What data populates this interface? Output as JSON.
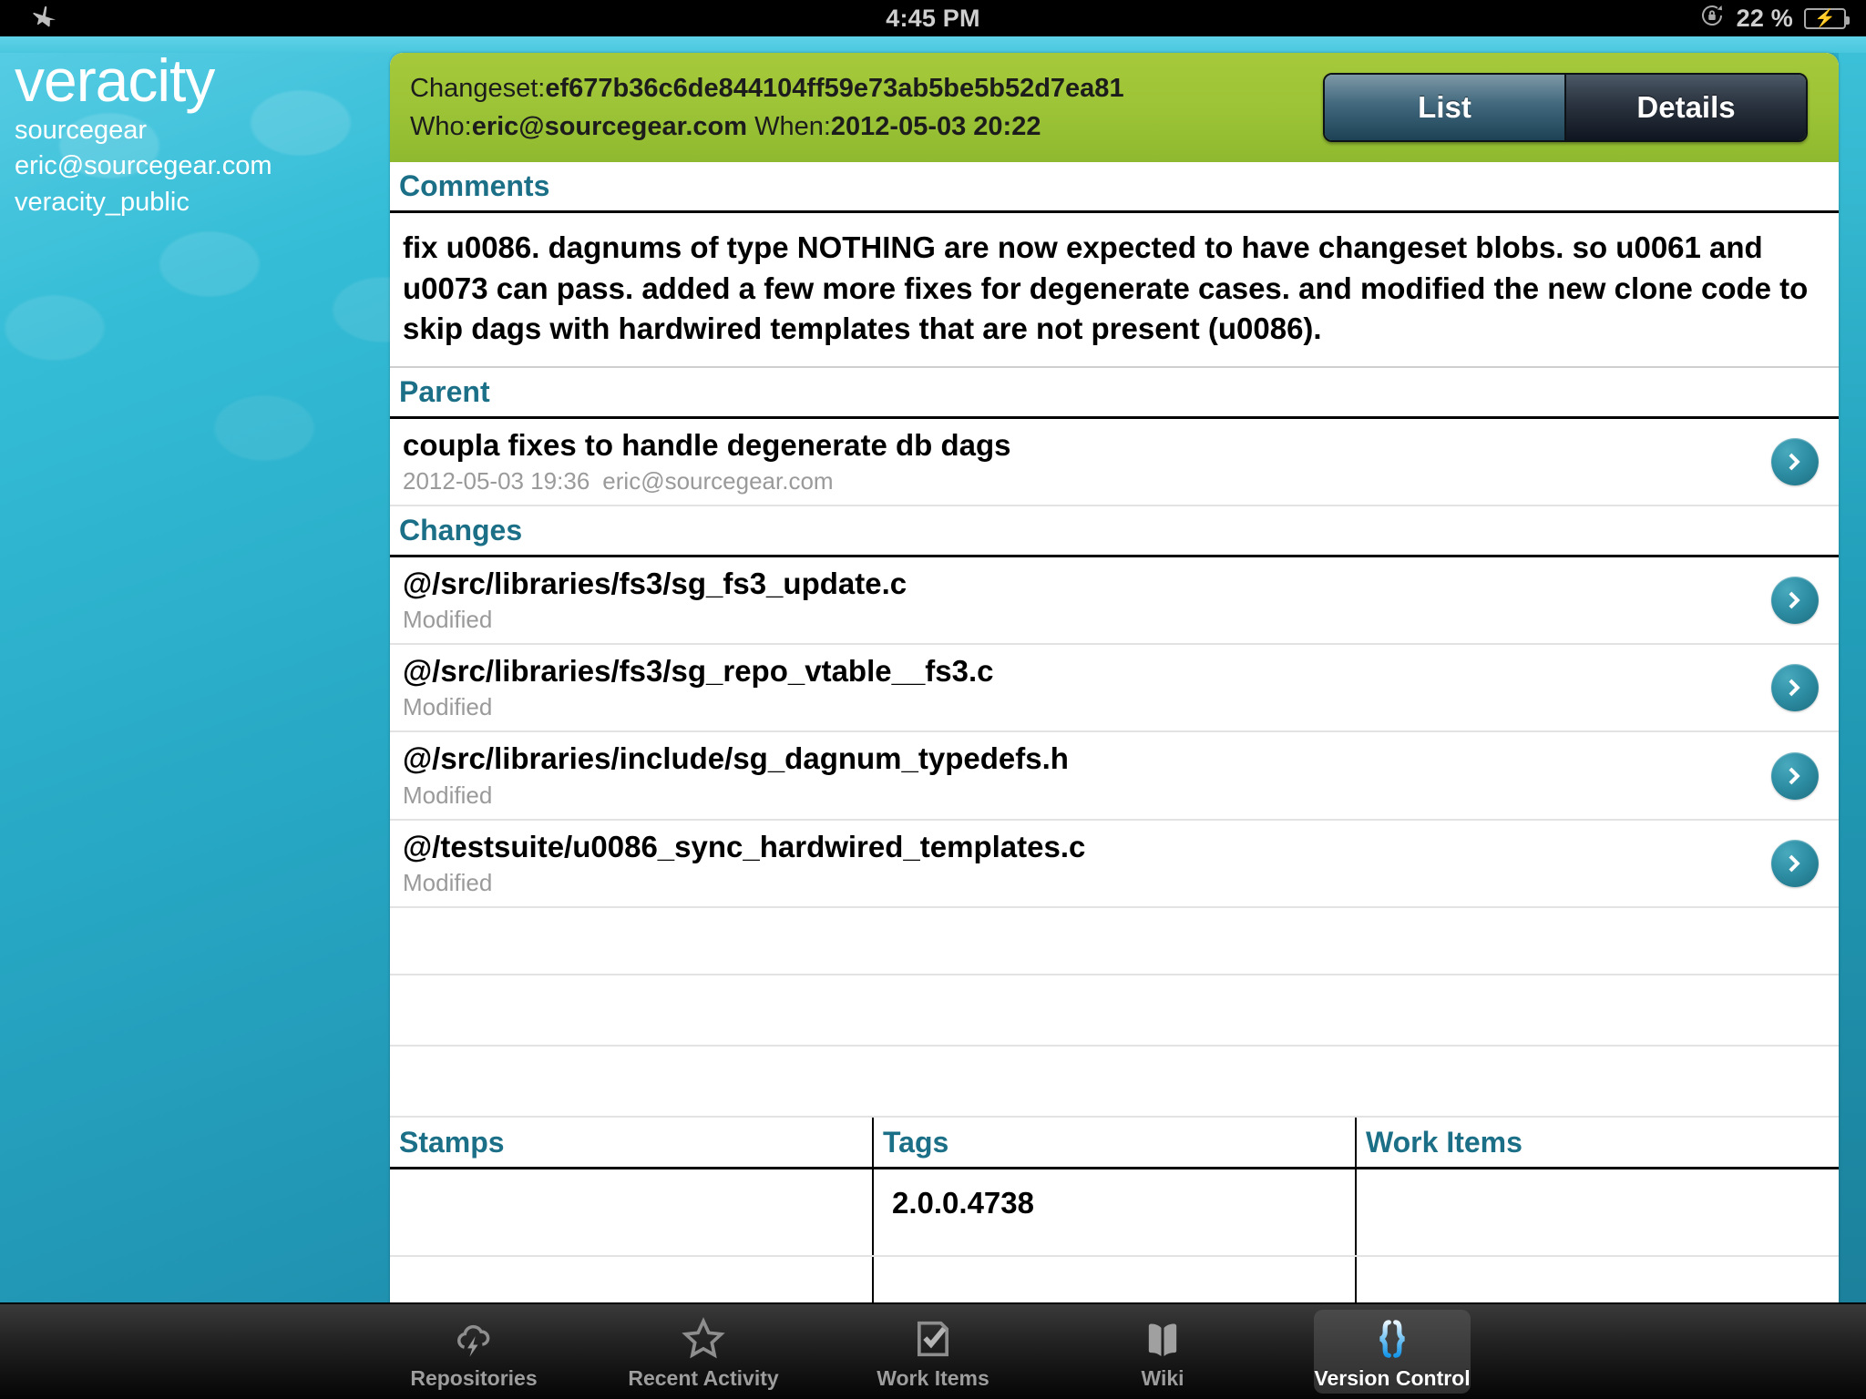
{
  "status_bar": {
    "airplane_icon": "airplane-icon",
    "time": "4:45 PM",
    "rotation_lock_icon": "rotation-lock-icon",
    "battery_percent": "22 %",
    "battery_icon": "battery-charging-icon"
  },
  "sidebar": {
    "app_name": "veracity",
    "org": "sourcegear",
    "user": "eric@sourcegear.com",
    "repo": "veracity_public"
  },
  "header": {
    "changeset_label": "Changeset:",
    "changeset_value": "ef677b36c6de844104ff59e73ab5be5b52d7ea81",
    "who_label": "Who:",
    "who_value": "eric@sourcegear.com",
    "when_label": "When:",
    "when_value": "2012-05-03 20:22",
    "segmented": {
      "list_label": "List",
      "details_label": "Details",
      "selected": "Details"
    }
  },
  "comments": {
    "heading": "Comments",
    "text": "fix u0086. dagnums of type NOTHING are now expected to have changeset blobs. so u0061 and u0073 can pass. added a few more fixes for degenerate cases. and modified the new clone code to skip dags with hardwired templates that are not present (u0086)."
  },
  "parent": {
    "heading": "Parent",
    "items": [
      {
        "title": "coupla fixes to handle degenerate db dags",
        "date": "2012-05-03 19:36",
        "author": "eric@sourcegear.com"
      }
    ]
  },
  "changes": {
    "heading": "Changes",
    "items": [
      {
        "path": "@/src/libraries/fs3/sg_fs3_update.c",
        "status": "Modified"
      },
      {
        "path": "@/src/libraries/fs3/sg_repo_vtable__fs3.c",
        "status": "Modified"
      },
      {
        "path": "@/src/libraries/include/sg_dagnum_typedefs.h",
        "status": "Modified"
      },
      {
        "path": "@/testsuite/u0086_sync_hardwired_templates.c",
        "status": "Modified"
      }
    ]
  },
  "bottom_table": {
    "columns": [
      "Stamps",
      "Tags",
      "Work Items"
    ],
    "rows": [
      {
        "stamps": "",
        "tags": "2.0.0.4738",
        "work_items": ""
      },
      {
        "stamps": "",
        "tags": "",
        "work_items": ""
      }
    ]
  },
  "tabbar": {
    "tabs": [
      {
        "label": "Repositories",
        "icon": "cloud-lightning-icon",
        "active": false
      },
      {
        "label": "Recent Activity",
        "icon": "star-icon",
        "active": false
      },
      {
        "label": "Work Items",
        "icon": "checklist-icon",
        "active": false
      },
      {
        "label": "Wiki",
        "icon": "open-book-icon",
        "active": false
      },
      {
        "label": "Version Control",
        "icon": "curly-braces-icon",
        "active": true
      }
    ]
  },
  "colors": {
    "brand_teal": "#1b7f9a",
    "header_green": "#9cc336",
    "section_heading": "#1b6f87",
    "chevron_teal": "#2e8fa5",
    "muted_text": "#9a9a9a"
  }
}
